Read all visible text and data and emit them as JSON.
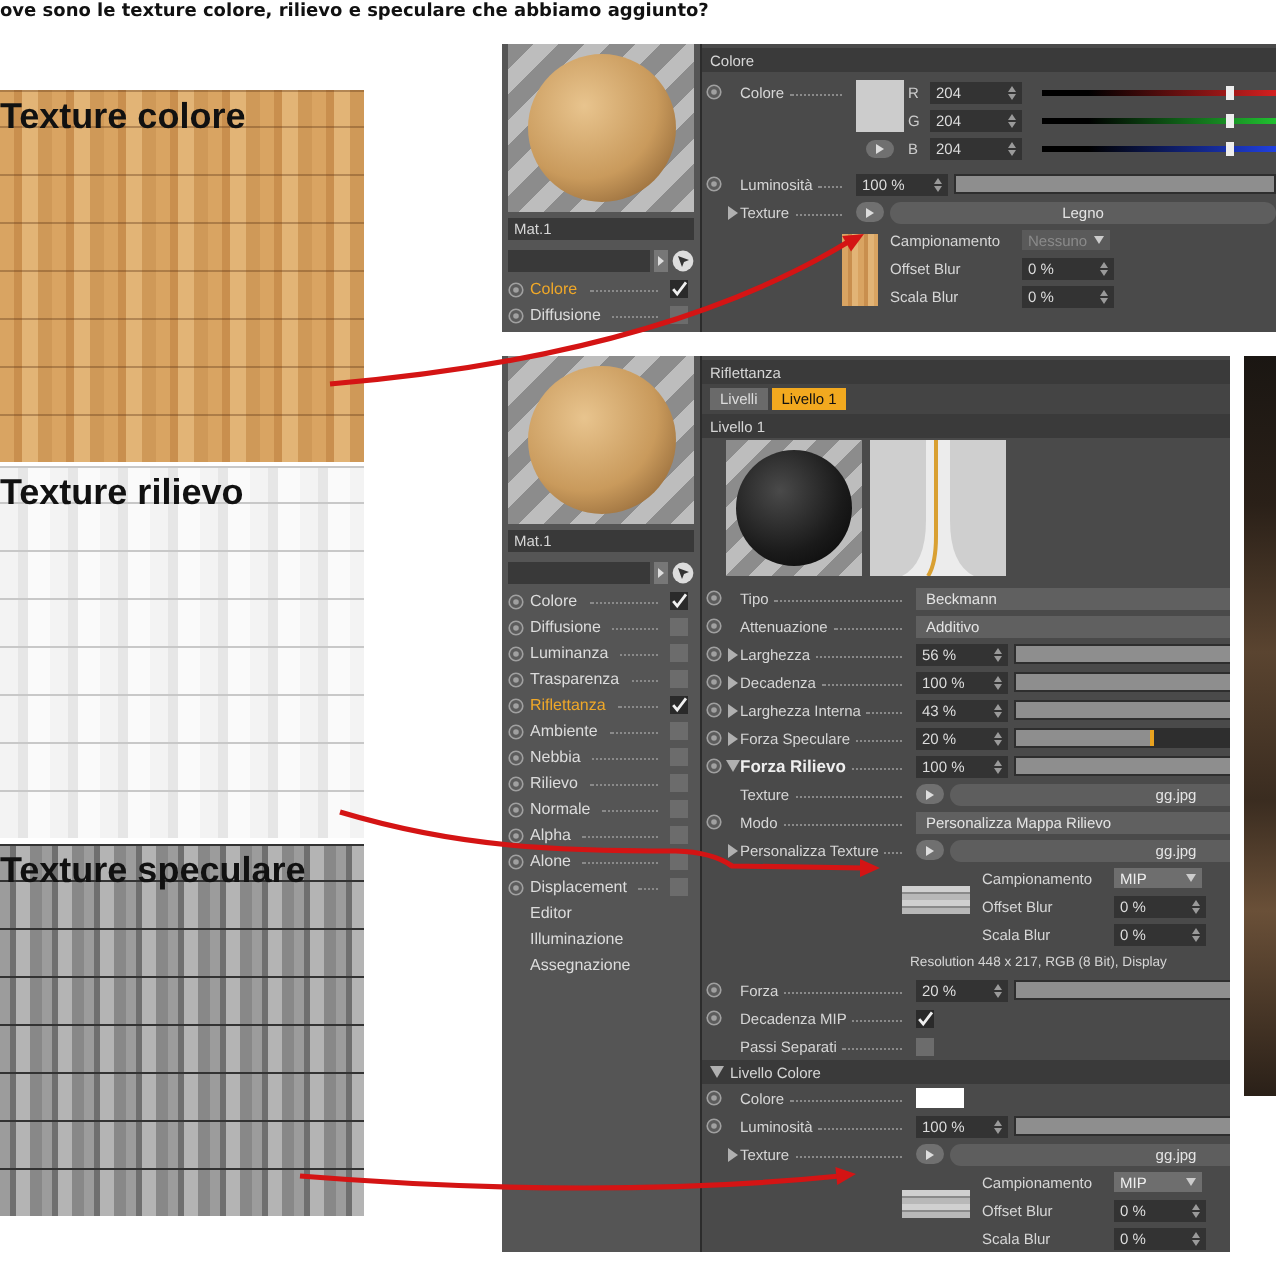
{
  "heading": "ove sono le texture colore, rilievo e speculare che abbiamo aggiunto?",
  "textures": [
    {
      "label": "Texture colore",
      "kind": "wood"
    },
    {
      "label": "Texture rilievo",
      "kind": "white"
    },
    {
      "label": "Texture speculare",
      "kind": "grey"
    }
  ],
  "panels": [
    {
      "sidebar": {
        "material_name": "Mat.1",
        "channels": [
          {
            "kind": "channel",
            "label": "Colore",
            "radio": true,
            "checked": true,
            "selected": true
          },
          {
            "kind": "channel",
            "label": "Diffusione",
            "radio": true,
            "checked": false,
            "selected": false
          }
        ]
      },
      "attributes": [
        {
          "kind": "header",
          "label": "Colore"
        },
        {
          "kind": "rgb",
          "label": "Colore",
          "radio": true,
          "channels": [
            {
              "name": "R",
              "value": "204",
              "level": 0.8
            },
            {
              "name": "G",
              "value": "204",
              "level": 0.8
            },
            {
              "name": "B",
              "value": "204",
              "level": 0.8
            }
          ]
        },
        {
          "kind": "slider",
          "label": "Luminosità",
          "radio": true,
          "value": "100 %",
          "level": 1
        },
        {
          "kind": "texture",
          "label": "Texture",
          "expanded": false,
          "file": "Legno"
        },
        {
          "kind": "options",
          "fields": [
            {
              "kind": "dropdown",
              "label": "Campionamento",
              "value": "Nessuno",
              "disabled": true
            },
            {
              "kind": "number",
              "label": "Offset Blur",
              "value": "0 %"
            },
            {
              "kind": "number",
              "label": "Scala Blur",
              "value": "0 %"
            }
          ]
        }
      ]
    },
    {
      "sidebar": {
        "material_name": "Mat.1",
        "channels": [
          {
            "kind": "channel",
            "label": "Colore",
            "radio": true,
            "checked": true,
            "selected": false
          },
          {
            "kind": "channel",
            "label": "Diffusione",
            "radio": true,
            "checked": false,
            "selected": false
          },
          {
            "kind": "channel",
            "label": "Luminanza",
            "radio": true,
            "checked": false,
            "selected": false
          },
          {
            "kind": "channel",
            "label": "Trasparenza",
            "radio": true,
            "checked": false,
            "selected": false
          },
          {
            "kind": "channel",
            "label": "Riflettanza",
            "radio": true,
            "checked": true,
            "selected": true
          },
          {
            "kind": "channel",
            "label": "Ambiente",
            "radio": true,
            "checked": false,
            "selected": false
          },
          {
            "kind": "channel",
            "label": "Nebbia",
            "radio": true,
            "checked": false,
            "selected": false
          },
          {
            "kind": "channel",
            "label": "Rilievo",
            "radio": true,
            "checked": false,
            "selected": false
          },
          {
            "kind": "channel",
            "label": "Normale",
            "radio": true,
            "checked": false,
            "selected": false
          },
          {
            "kind": "channel",
            "label": "Alpha",
            "radio": true,
            "checked": false,
            "selected": false
          },
          {
            "kind": "channel",
            "label": "Alone",
            "radio": true,
            "checked": false,
            "selected": false
          },
          {
            "kind": "channel",
            "label": "Displacement",
            "radio": true,
            "checked": false,
            "selected": false
          },
          {
            "kind": "page",
            "label": "Editor",
            "selected": false
          },
          {
            "kind": "page",
            "label": "Illuminazione",
            "selected": false
          },
          {
            "kind": "page",
            "label": "Assegnazione",
            "selected": false
          }
        ]
      },
      "attributes": [
        {
          "kind": "header",
          "label": "Riflettanza"
        },
        {
          "kind": "tabs",
          "tabs": [
            {
              "label": "Livelli",
              "selected": false
            },
            {
              "label": "Livello 1",
              "selected": true
            }
          ]
        },
        {
          "kind": "header",
          "label": "Livello 1"
        },
        {
          "kind": "preview"
        },
        {
          "kind": "dropdown",
          "label": "Tipo",
          "radio": true,
          "value": "Beckmann"
        },
        {
          "kind": "dropdown",
          "label": "Attenuazione",
          "radio": true,
          "value": "Additivo"
        },
        {
          "kind": "slider",
          "label": "Larghezza",
          "radio": true,
          "expanded": false,
          "value": "56 %",
          "level": 1
        },
        {
          "kind": "slider",
          "label": "Decadenza",
          "radio": true,
          "expanded": false,
          "value": "100 %",
          "level": 1
        },
        {
          "kind": "slider",
          "label": "Larghezza Interna",
          "radio": true,
          "expanded": false,
          "value": "43 %",
          "level": 0.8
        },
        {
          "kind": "slider",
          "label": "Forza Speculare",
          "radio": true,
          "expanded": false,
          "value": "20 %",
          "level": 0.36
        },
        {
          "kind": "slider",
          "label": "Forza Rilievo",
          "radio": true,
          "expanded": true,
          "bold": true,
          "value": "100 %",
          "level": 1
        },
        {
          "kind": "texture",
          "label": "Texture",
          "file": "gg.jpg"
        },
        {
          "kind": "dropdown",
          "label": "Modo",
          "radio": true,
          "value": "Personalizza Mappa Rilievo"
        },
        {
          "kind": "texture",
          "label": "Personalizza Texture",
          "expanded": false,
          "file": "gg.jpg"
        },
        {
          "kind": "options",
          "fields": [
            {
              "kind": "dropdown",
              "label": "Campionamento",
              "value": "MIP",
              "disabled": false
            },
            {
              "kind": "number",
              "label": "Offset Blur",
              "value": "0 %"
            },
            {
              "kind": "number",
              "label": "Scala Blur",
              "value": "0 %"
            }
          ]
        },
        {
          "kind": "info",
          "text": "Resolution 448 x 217, RGB (8 Bit), Display"
        },
        {
          "kind": "slider",
          "label": "Forza",
          "radio": true,
          "value": "20 %",
          "level": 1
        },
        {
          "kind": "checkbox",
          "label": "Decadenza MIP",
          "radio": true,
          "checked": true
        },
        {
          "kind": "checkbox",
          "label": "Passi Separati",
          "checked": false
        },
        {
          "kind": "header",
          "label": "Livello Colore",
          "expanded": true
        },
        {
          "kind": "color",
          "label": "Colore",
          "radio": true
        },
        {
          "kind": "slider",
          "label": "Luminosità",
          "radio": true,
          "value": "100 %",
          "level": 1
        },
        {
          "kind": "texture",
          "label": "Texture",
          "expanded": false,
          "file": "gg.jpg"
        },
        {
          "kind": "options",
          "fields": [
            {
              "kind": "dropdown",
              "label": "Campionamento",
              "value": "MIP",
              "disabled": false
            },
            {
              "kind": "number",
              "label": "Offset Blur",
              "value": "0 %"
            },
            {
              "kind": "number",
              "label": "Scala Blur",
              "value": "0 %"
            }
          ]
        }
      ]
    }
  ]
}
